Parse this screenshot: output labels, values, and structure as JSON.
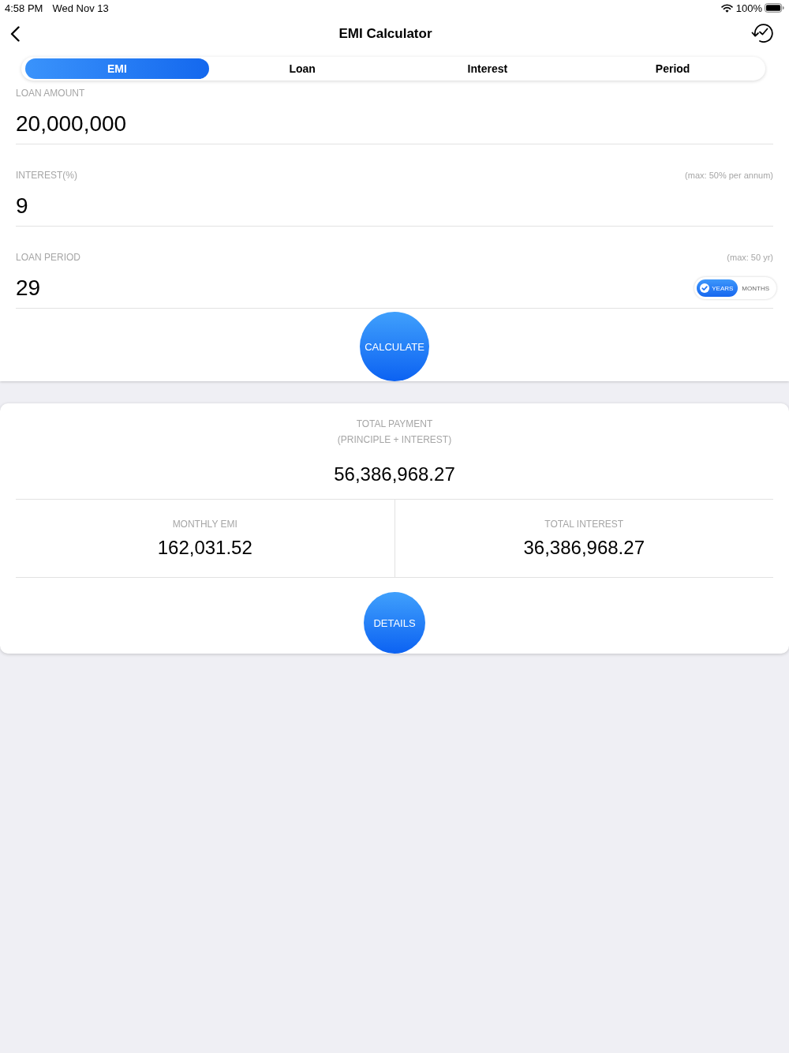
{
  "status_bar": {
    "time": "4:58 PM",
    "date": "Wed Nov 13",
    "battery": "100%"
  },
  "nav": {
    "title": "EMI Calculator"
  },
  "tabs": [
    {
      "label": "EMI",
      "selected": true
    },
    {
      "label": "Loan",
      "selected": false
    },
    {
      "label": "Interest",
      "selected": false
    },
    {
      "label": "Period",
      "selected": false
    }
  ],
  "fields": [
    {
      "label": "LOAN AMOUNT",
      "value": "20,000,000"
    },
    {
      "label": "INTEREST(%)",
      "hint": "(max: 50% per annum)",
      "value": "9"
    },
    {
      "label": "LOAN PERIOD",
      "hint": "(max: 50 yr)",
      "value": "29",
      "units": [
        {
          "label": "YEARS",
          "selected": true
        },
        {
          "label": "MONTHS",
          "selected": false
        }
      ]
    }
  ],
  "calculate_button": "CALCULATE",
  "results": {
    "total": {
      "label": "TOTAL PAYMENT",
      "sublabel": "(PRINCIPLE + INTEREST)",
      "value": "56,386,968.27"
    },
    "breakdown": [
      {
        "label": "MONTHLY EMI",
        "value": "162,031.52"
      },
      {
        "label": "TOTAL INTEREST",
        "value": "36,386,968.27"
      }
    ],
    "details_button": "DETAILS"
  }
}
